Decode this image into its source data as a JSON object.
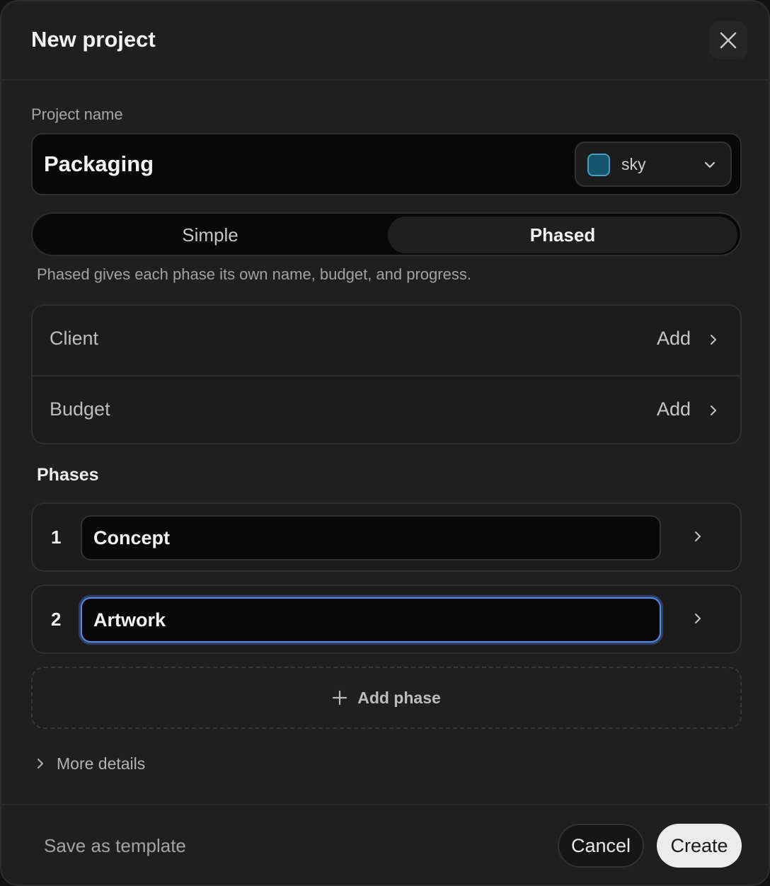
{
  "dialog": {
    "title": "New project"
  },
  "project": {
    "name_label": "Project name",
    "name_value": "Packaging",
    "color": {
      "name": "sky",
      "swatch": "#14546c",
      "border": "#4a9ec4"
    }
  },
  "mode": {
    "options": [
      "Simple",
      "Phased"
    ],
    "selected": "Phased",
    "hint": "Phased gives each phase its own name, budget, and progress."
  },
  "fields": [
    {
      "label": "Client",
      "action": "Add"
    },
    {
      "label": "Budget",
      "action": "Add"
    }
  ],
  "phases": {
    "title": "Phases",
    "items": [
      {
        "number": "1",
        "name": "Concept"
      },
      {
        "number": "2",
        "name": "Artwork"
      }
    ],
    "add_label": "Add phase"
  },
  "more_details": "More details",
  "footer": {
    "save_template": "Save as template",
    "cancel": "Cancel",
    "create": "Create"
  },
  "colors": {
    "focus": "#5b88e6"
  }
}
